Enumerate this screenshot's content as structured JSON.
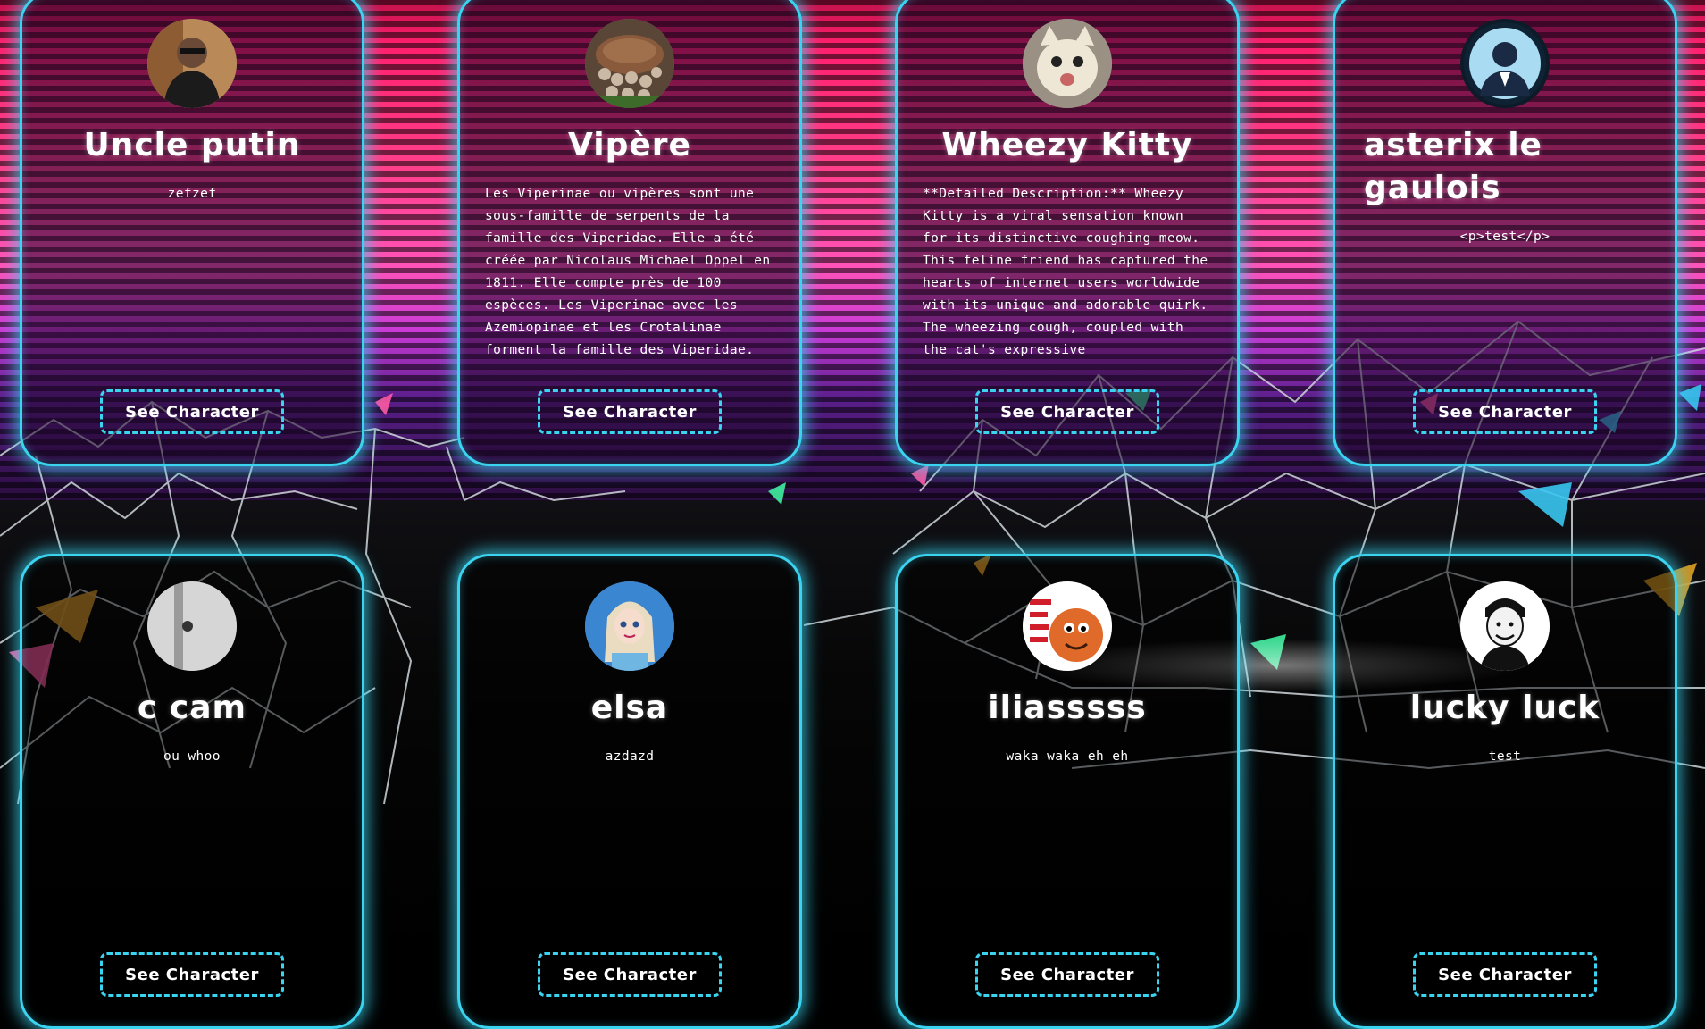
{
  "cards": [
    {
      "name": "Uncle putin",
      "description": "zefzef",
      "button": "See Character",
      "avatar_icon": "man-portrait-icon"
    },
    {
      "name": "Vipère",
      "description": "Les Viperinae ou vipères sont une sous-famille de serpents de la famille des Viperidae. Elle a été créée par Nicolaus Michael Oppel en 1811. Elle compte près de 100 espèces. Les Viperinae avec les Azemiopinae et les Crotalinae forment la famille des Viperidae.",
      "button": "See Character",
      "avatar_icon": "mushroom-house-icon"
    },
    {
      "name": "Wheezy Kitty",
      "description": "**Detailed Description:** Wheezy Kitty is a viral sensation known for its distinctive coughing meow. This feline friend has captured the hearts of internet users worldwide with its unique and adorable quirk. The wheezing cough, coupled with the cat's expressive",
      "button": "See Character",
      "avatar_icon": "cat-face-icon"
    },
    {
      "name": "asterix le gaulois",
      "description": "<p>test</p>",
      "button": "See Character",
      "avatar_icon": "user-suit-icon"
    },
    {
      "name": "c cam",
      "description": "ou whoo",
      "button": "See Character",
      "avatar_icon": "grey-photo-icon"
    },
    {
      "name": "elsa",
      "description": "azdazd",
      "button": "See Character",
      "avatar_icon": "elsa-portrait-icon"
    },
    {
      "name": "iliasssss",
      "description": "waka waka eh eh",
      "button": "See Character",
      "avatar_icon": "orange-monster-icon"
    },
    {
      "name": "lucky luck",
      "description": "test",
      "button": "See Character",
      "avatar_icon": "bw-portrait-icon"
    }
  ],
  "theme": {
    "accent": "#3ad3f0",
    "sky_top": "#ff1f6d",
    "sky_mid": "#ff52b8",
    "ground": "#000000"
  }
}
